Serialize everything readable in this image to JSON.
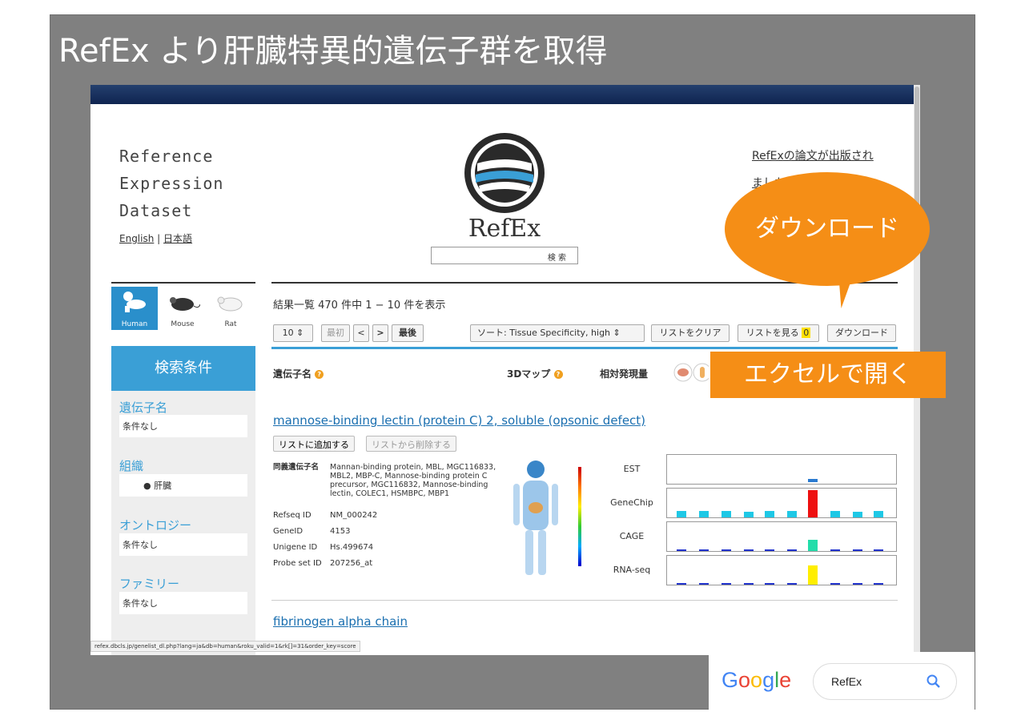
{
  "slide": {
    "title": "RefEx より肝臓特異的遺伝子群を取得"
  },
  "site": {
    "title_lines": [
      "Reference",
      "Expression",
      "Dataset"
    ],
    "lang_en": "English",
    "lang_sep": "|",
    "lang_ja": "日本語",
    "logo_text": "RefEx",
    "search_button": "検 索",
    "news_line1": "RefExの論文が出版され",
    "news_line2": "ました"
  },
  "sidebar": {
    "animals": [
      {
        "label": "Human"
      },
      {
        "label": "Mouse"
      },
      {
        "label": "Rat"
      }
    ],
    "header": "検索条件",
    "sections": [
      {
        "title": "遺伝子名",
        "value": "条件なし"
      },
      {
        "title": "組織",
        "value": "● 肝臓"
      },
      {
        "title": "オントロジー",
        "value": "条件なし"
      },
      {
        "title": "ファミリー",
        "value": "条件なし"
      }
    ]
  },
  "results": {
    "summary": "結果一覧 470 件中 1 − 10 件を表示",
    "per_page": "10",
    "first": "最初",
    "prev": "<",
    "next": ">",
    "last": "最後",
    "sort_label": "ソート:",
    "sort_value": "Tissue Specificity, high",
    "clear_list": "リストをクリア",
    "view_list": "リストを見る",
    "list_count": "0",
    "download": "ダウンロード",
    "col_gene": "遺伝子名",
    "col_map": "3Dマップ",
    "col_expr": "相対発現量"
  },
  "gene1": {
    "name": "mannose-binding lectin (protein C) 2, soluble (opsonic defect)",
    "add_btn": "リストに追加する",
    "remove_btn": "リストから削除する",
    "synonyms_label": "同義遺伝子名",
    "synonyms": "Mannan-binding protein, MBL, MGC116833, MBL2, MBP-C, Mannose-binding protein C precursor, MGC116832, Mannose-binding lectin, COLEC1, HSMBPC, MBP1",
    "refseq_label": "Refseq ID",
    "refseq": "NM_000242",
    "geneid_label": "GeneID",
    "geneid": "4153",
    "unigene_label": "Unigene ID",
    "unigene": "Hs.499674",
    "probe_label": "Probe set ID",
    "probe": "207256_at",
    "expr_labels": [
      "EST",
      "GeneChip",
      "CAGE",
      "RNA-seq"
    ]
  },
  "gene2": {
    "name": "fibrinogen alpha chain"
  },
  "status_url": "refex.dbcls.jp/genelist_dl.php?lang=ja&db=human&roku_valid=1&rk[]=31&order_key=score",
  "callouts": {
    "download": "ダウンロード",
    "excel": "エクセルで開く"
  },
  "google": {
    "query": "RefEx",
    "logo": "Google"
  },
  "colors": {
    "accent": "#3a9fd6",
    "callout": "#f58e16",
    "link": "#1a6fb0"
  }
}
